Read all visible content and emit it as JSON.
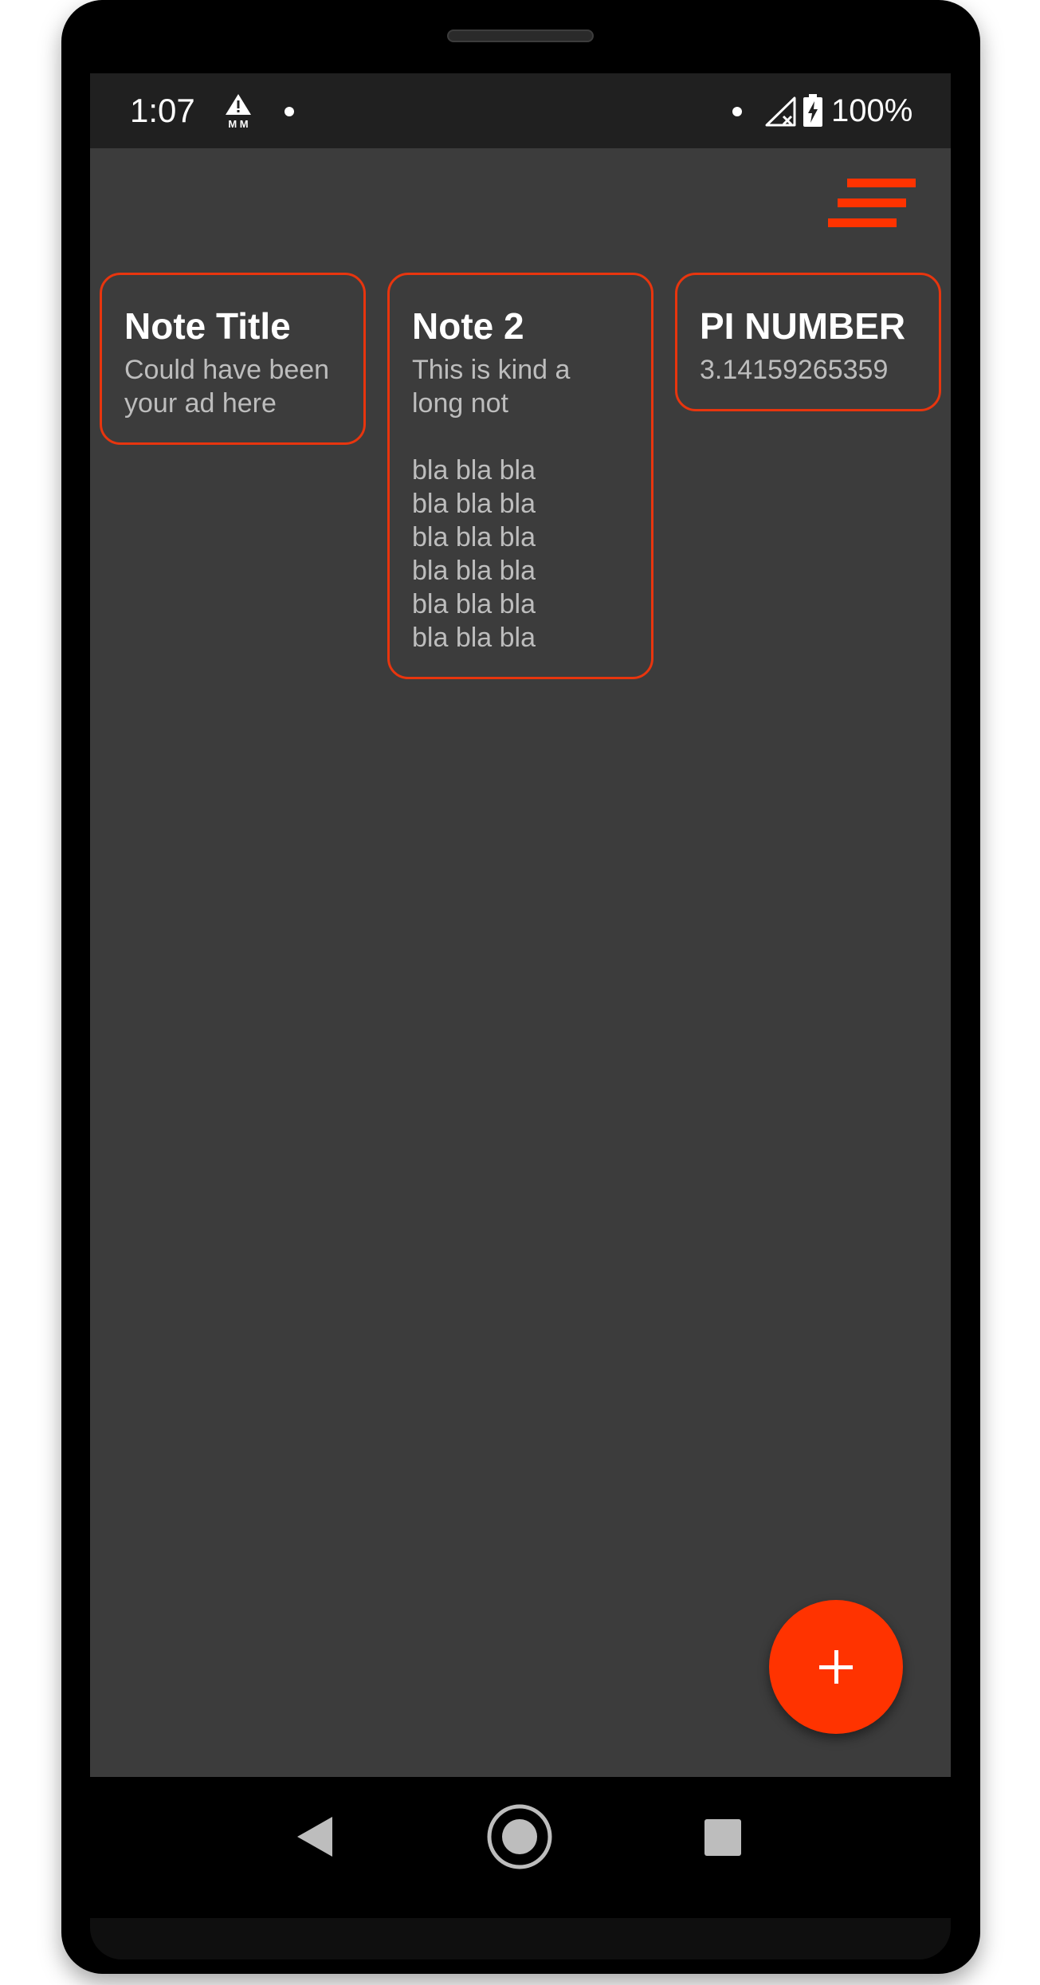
{
  "status_bar": {
    "time": "1:07",
    "battery_percent": "100%",
    "icons": [
      "alert-mm-icon",
      "notification-dot-icon",
      "signal-off-icon",
      "battery-charging-icon"
    ]
  },
  "toolbar": {
    "menu_icon": "sort-menu-icon"
  },
  "notes": [
    {
      "title": "Note Title",
      "body": "Could have been\nyour ad here"
    },
    {
      "title": "Note 2",
      "body": "This is kind a\nlong not\n\nbla bla bla\nbla bla bla\nbla bla bla\nbla bla bla\nbla bla bla\nbla bla bla"
    },
    {
      "title": "PI NUMBER",
      "body": "3.14159265359"
    }
  ],
  "fab": {
    "icon": "plus-icon"
  },
  "nav_bar": {
    "icons": [
      "back-icon",
      "home-icon",
      "recents-icon"
    ]
  },
  "colors": {
    "accent": "#ff3300",
    "card_border": "#e8350e",
    "background": "#3c3c3c",
    "status_bar": "#202020",
    "title_text": "#ffffff",
    "body_text": "#bdbdbd"
  }
}
